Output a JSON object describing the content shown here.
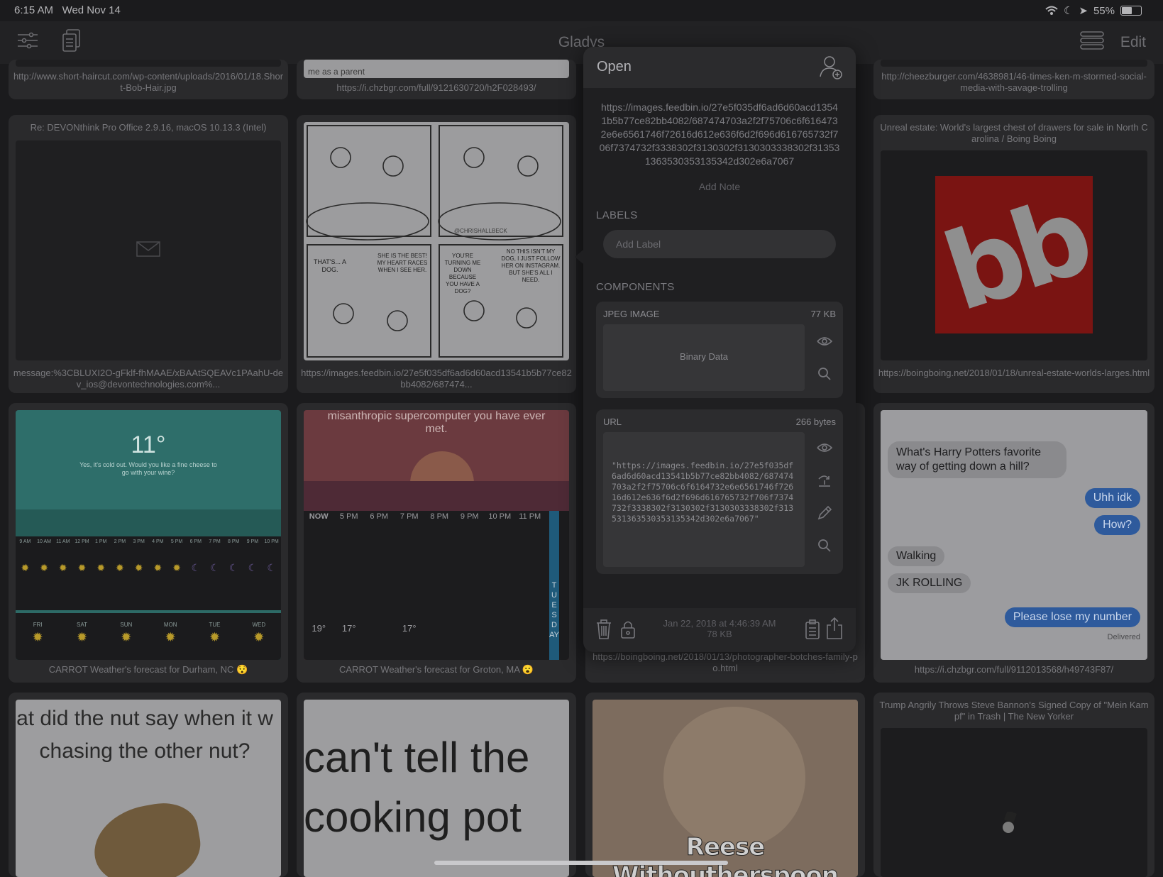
{
  "status": {
    "time": "6:15 AM",
    "date": "Wed Nov 14",
    "battery": "55%",
    "battery_level": 0.55
  },
  "nav": {
    "title": "Gladys",
    "edit_label": "Edit"
  },
  "cells": {
    "r0c0_caption": "http://www.short-haircut.com/wp-content/uploads/2016/01/18.Short-Bob-Hair.jpg",
    "r0c1_caption": "https://i.chzbgr.com/full/9121630720/h2F028493/",
    "r0c1_snippet": "me as a parent",
    "r0c3_caption": "http://cheezburger.com/4638981/46-times-ken-m-stormed-social-media-with-savage-trolling",
    "r1c0_title": "Re: DEVONthink Pro Office 2.9.16, macOS 10.13.3 (Intel)",
    "r1c0_caption": "message:%3CBLUXI2O-gFklf-fhMAAE/xBAAtSQEAVc1PAahU-dev_ios@devontechnologies.com%...",
    "r1c1_caption": "https://images.feedbin.io/27e5f035df6ad6d60acd13541b5b77ce82bb4082/687474...",
    "r1c1_panels": [
      "THAT'S... A DOG.",
      "SHE IS THE BEST! MY HEART RACES WHEN I SEE HER.",
      "YOU'RE TURNING ME DOWN BECAUSE YOU HAVE A DOG?",
      "NO THIS ISN'T MY DOG, I JUST FOLLOW HER ON INSTAGRAM. BUT SHE'S ALL I NEED."
    ],
    "r1c1_signature": "@CHRISHALLBECK",
    "r1c3_title": "Unreal estate: World's largest chest of drawers for sale in North Carolina / Boing Boing",
    "r1c3_logo": "bb",
    "r1c3_caption": "https://boingboing.net/2018/01/18/unreal-estate-worlds-larges.html",
    "r2c0_caption": "CARROT Weather's forecast for Durham, NC 😯",
    "r2c0_temp": "11°",
    "r2c0_quip": "Yes, it's cold out. Would you like a fine cheese to go with your wine?",
    "r2c0_hours": [
      "9 AM",
      "10 AM",
      "11 AM",
      "12 PM",
      "1 PM",
      "2 PM",
      "3 PM",
      "4 PM",
      "5 PM",
      "6 PM",
      "7 PM",
      "8 PM",
      "9 PM",
      "10 PM"
    ],
    "r2c0_days": [
      "FRI",
      "SAT",
      "SUN",
      "MON",
      "TUE",
      "WED"
    ],
    "r2c1_caption": "CARROT Weather's forecast for Groton, MA 😮",
    "r2c1_header": "misanthropic supercomputer you have ever met.",
    "r2c1_hours": [
      "NOW",
      "5 PM",
      "6 PM",
      "7 PM",
      "8 PM",
      "9 PM",
      "10 PM",
      "11 PM"
    ],
    "r2c1_temps": [
      "19°",
      "17°",
      "17°"
    ],
    "r2c1_day": "TUESDAY",
    "r2c2_caption": "https://boingboing.net/2018/01/13/photographer-botches-family-po.html",
    "r2c3_caption": "https://i.chzbgr.com/full/9112013568/h49743F87/",
    "r2c3_msgs": [
      "What's Harry Potters favorite way of getting down a hill?",
      "Uhh idk",
      "How?",
      "Walking",
      "JK ROLLING",
      "Please lose my number"
    ],
    "r2c3_delivered": "Delivered",
    "r3c0_text": "at did the nut say when it w chasing the other nut?",
    "r3c1_text": "can't tell the cooking pot",
    "r3c2_text": "Reese Withoutherspoon",
    "r3c3_title": "Trump Angrily Throws Steve Bannon's Signed Copy of \"Mein Kampf\" in Trash | The New Yorker"
  },
  "popover": {
    "open_label": "Open",
    "url": "https://images.feedbin.io/27e5f035df6ad6d60acd13541b5b77ce82bb4082/687474703a2f2f75706c6f6164732e6e6561746f72616d612e636f6d2f696d616765732f706f7374732f3338302f3130302f3130303338302f313531363530353135342d302e6a7067",
    "add_note": "Add Note",
    "labels_title": "LABELS",
    "add_label_placeholder": "Add Label",
    "components_title": "COMPONENTS",
    "jpeg": {
      "type": "JPEG IMAGE",
      "size": "77 KB",
      "content": "Binary Data"
    },
    "url_comp": {
      "type": "URL",
      "size": "266 bytes",
      "content": "\"https://images.feedbin.io/27e5f035df6ad6d60acd13541b5b77ce82bb4082/687474703a2f2f75706c6f6164732e6e6561746f72616d612e636f6d2f696d616765732f706f7374732f3338302f3130302f3130303338302f313531363530353135342d302e6a7067\""
    },
    "footer_date": "Jan 22, 2018 at 4:46:39 AM",
    "footer_size": "78 KB"
  }
}
